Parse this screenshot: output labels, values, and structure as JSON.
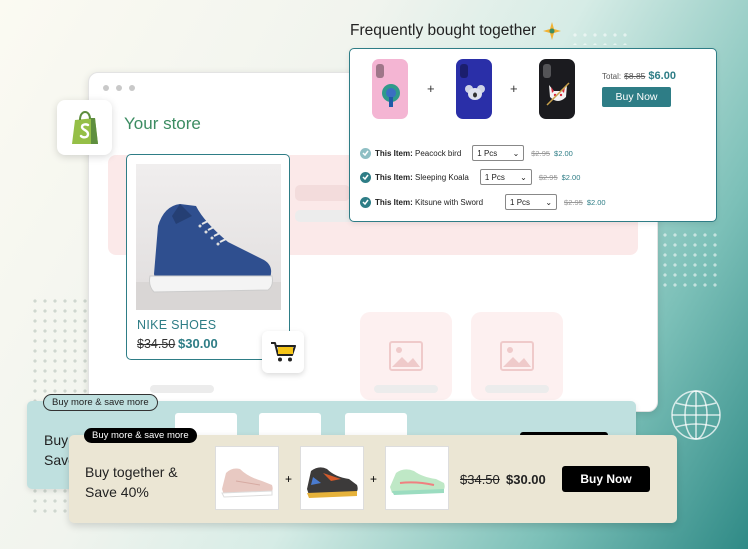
{
  "colors": {
    "accent": "#2e7d86",
    "store_green": "#3c8c62",
    "bundle_back_bg": "#bfe0df",
    "bundle_front_bg": "#ebe6d4",
    "buy_button": "#000000"
  },
  "store": {
    "title": "Your store",
    "logo_icon": "shopify-bag-icon"
  },
  "product_card": {
    "name": "NIKE SHOES",
    "old_price": "$34.50",
    "new_price": "$30.00",
    "image_icon": "blue-sneaker-icon",
    "cart_icon": "cart-icon"
  },
  "fbt": {
    "title": "Frequently bought together",
    "title_icon": "sparkle-icon",
    "total_label": "Total:",
    "total_old": "$8.85",
    "total_new": "$6.00",
    "buy_label": "Buy Now",
    "plus": "+",
    "items": [
      {
        "prefix": "This Item:",
        "name": "Peacock bird",
        "qty": "1 Pcs",
        "old": "$2.95",
        "new": "$2.00",
        "case_color": "#f4b5d3"
      },
      {
        "prefix": "This Item:",
        "name": "Sleeping Koala",
        "qty": "1 Pcs",
        "old": "$2.95",
        "new": "$2.00",
        "case_color": "#2a2fa8"
      },
      {
        "prefix": "This Item:",
        "name": "Kitsune with Sword",
        "qty": "1 Pcs",
        "old": "$2.95",
        "new": "$2.00",
        "case_color": "#1b1b1f"
      }
    ]
  },
  "bundle_back": {
    "badge": "Buy more & save more",
    "text_line1": "Buy",
    "text_line2": "Save"
  },
  "bundle_front": {
    "badge": "Buy more & save more",
    "text_line1": "Buy together &",
    "text_line2": "Save 40%",
    "plus": "+",
    "old_price": "$34.50",
    "new_price": "$30.00",
    "buy_label": "Buy Now",
    "items": [
      "pink-sneaker-icon",
      "multicolor-sneaker-icon",
      "mint-sneaker-icon"
    ]
  }
}
